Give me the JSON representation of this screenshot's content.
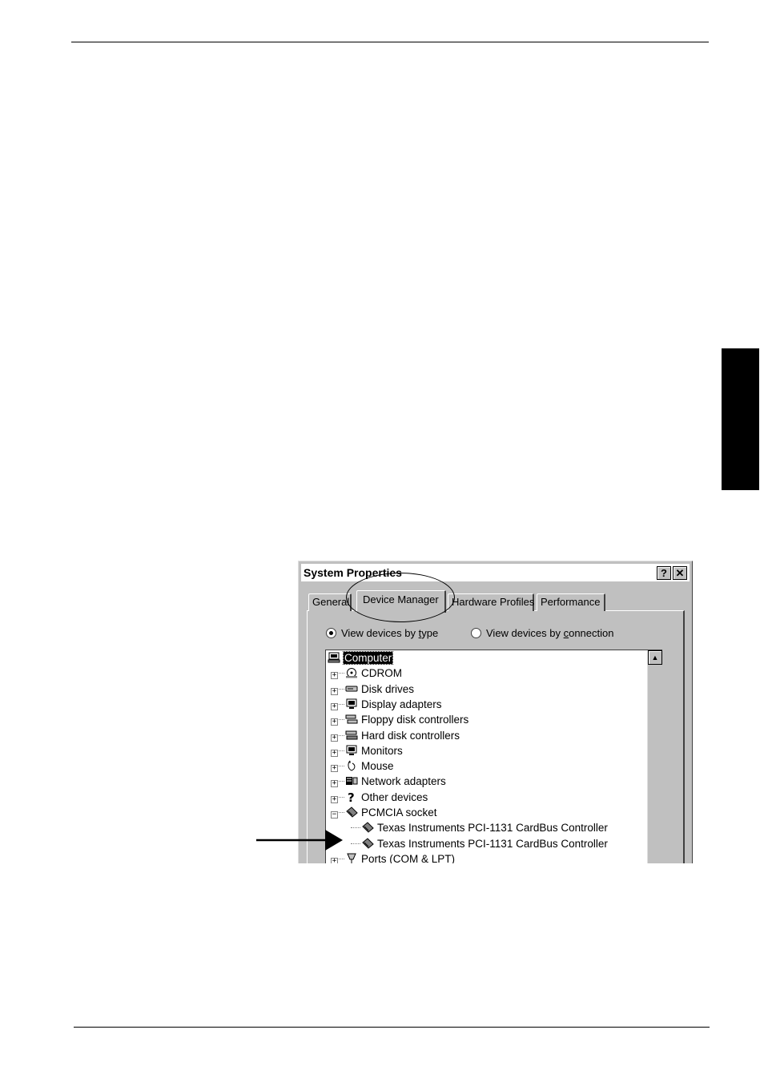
{
  "dialog": {
    "title": "System Properties",
    "help_glyph": "?",
    "close_glyph": "✕",
    "tabs": [
      {
        "label": "General"
      },
      {
        "label": "Device Manager"
      },
      {
        "label": "Hardware Profiles"
      },
      {
        "label": "Performance"
      }
    ],
    "view_options": {
      "by_type": {
        "prefix": "View devices by ",
        "accel": "t",
        "suffix": "ype",
        "selected": true
      },
      "by_connection": {
        "prefix": "View devices by ",
        "accel": "c",
        "suffix": "onnection",
        "selected": false
      }
    },
    "tree": {
      "root": "Computer",
      "items": [
        {
          "label": "CDROM",
          "icon": "cdrom-icon"
        },
        {
          "label": "Disk drives",
          "icon": "disk-drive-icon"
        },
        {
          "label": "Display adapters",
          "icon": "display-icon"
        },
        {
          "label": "Floppy disk controllers",
          "icon": "floppy-controller-icon"
        },
        {
          "label": "Hard disk controllers",
          "icon": "hard-disk-controller-icon"
        },
        {
          "label": "Monitors",
          "icon": "monitor-icon"
        },
        {
          "label": "Mouse",
          "icon": "mouse-icon"
        },
        {
          "label": "Network adapters",
          "icon": "network-icon"
        },
        {
          "label": "Other devices",
          "icon": "question-icon"
        },
        {
          "label": "PCMCIA socket",
          "icon": "pcmcia-icon",
          "expanded": true
        },
        {
          "label": "Texas Instruments PCI-1131 CardBus Controller",
          "icon": "pcmcia-icon",
          "child": true
        },
        {
          "label": "Texas Instruments PCI-1131 CardBus Controller",
          "icon": "pcmcia-icon",
          "child": true
        },
        {
          "label": "Ports (COM & LPT)",
          "icon": "port-icon"
        }
      ]
    }
  }
}
